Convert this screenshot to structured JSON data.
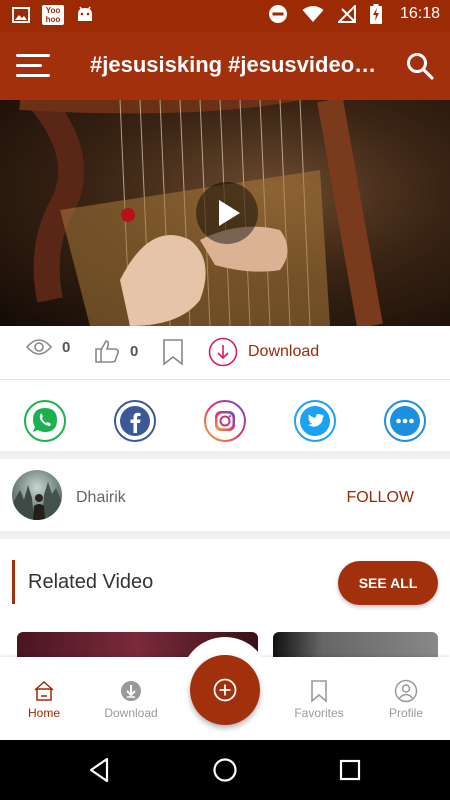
{
  "status_bar": {
    "time": "16:18",
    "left_icons": [
      "image-icon",
      "yoohoo-icon",
      "android-icon"
    ],
    "yoohoo_text_top": "Yoo",
    "yoohoo_text_bottom": "hoo",
    "right_icons": [
      "do-not-disturb-icon",
      "wifi-icon",
      "no-signal-icon",
      "battery-charging-icon"
    ]
  },
  "app_bar": {
    "title": "#jesusisking #jesusvideostatus",
    "menu_icon": "hamburger-menu-icon",
    "search_icon": "search-icon"
  },
  "video": {
    "play_icon": "play-icon"
  },
  "actions": {
    "views": "0",
    "likes": "0",
    "download_label": "Download"
  },
  "share": {
    "items": [
      "whatsapp-icon",
      "facebook-icon",
      "instagram-icon",
      "twitter-icon",
      "more-icon"
    ]
  },
  "user": {
    "name": "Dhairik",
    "follow_label": "FOLLOW"
  },
  "related": {
    "title": "Related Video",
    "see_all_label": "SEE ALL"
  },
  "bottom_nav": {
    "items": [
      {
        "label": "Home",
        "icon": "home-icon",
        "active": true
      },
      {
        "label": "Download",
        "icon": "download-icon",
        "active": false
      },
      {
        "label": "Favorites",
        "icon": "bookmark-icon",
        "active": false
      },
      {
        "label": "Profile",
        "icon": "profile-icon",
        "active": false
      }
    ],
    "fab_icon": "add-icon"
  },
  "colors": {
    "primary": "#a3300c",
    "status_bar": "#9c2a05",
    "whatsapp": "#1bb24e",
    "facebook": "#3b5998",
    "instagram": "#c13584",
    "twitter": "#1da1f2",
    "more": "#1d8fe0"
  }
}
